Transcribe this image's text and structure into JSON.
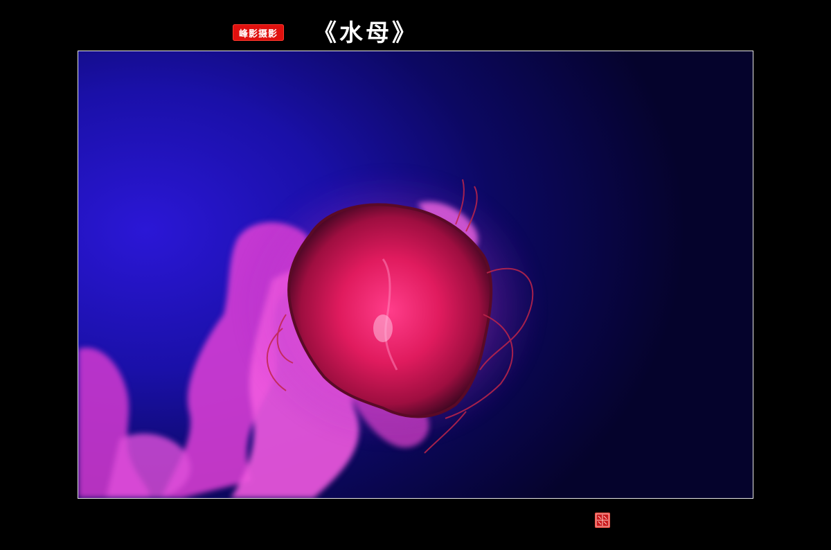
{
  "header": {
    "brand_stamp_text": "峰影摄影",
    "title": "《水母》"
  },
  "photo": {
    "subject": "jellyfish",
    "background_color": "#1a10a8",
    "bell_color": "#c8164e",
    "tentacle_color": "#e040d0"
  },
  "seal": {
    "color": "#c8181b"
  }
}
